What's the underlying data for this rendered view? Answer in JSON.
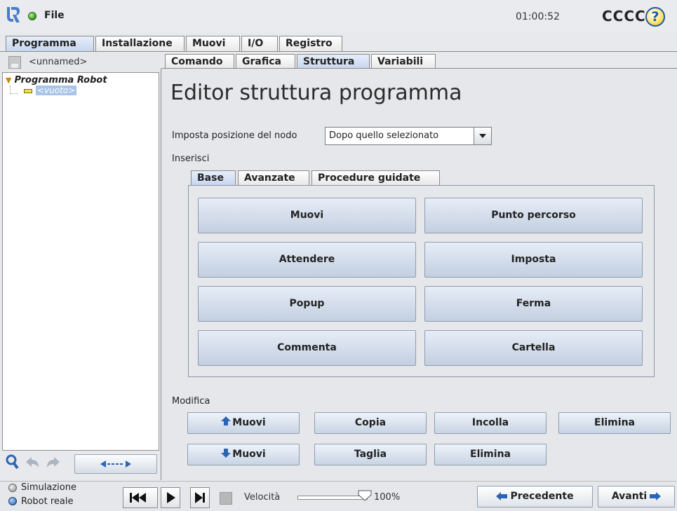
{
  "titlebar": {
    "menu_file": "File",
    "clock": "01:00:52",
    "robot_name": "CCCC",
    "help_glyph": "?"
  },
  "main_tabs": [
    {
      "label": "Programma"
    },
    {
      "label": "Installazione"
    },
    {
      "label": "Muovi"
    },
    {
      "label": "I/O"
    },
    {
      "label": "Registro"
    }
  ],
  "main_tab_active": "Programma",
  "tree": {
    "program_name": "<unnamed>",
    "root_label": "Programma Robot",
    "empty_label": "<vuoto>"
  },
  "sub_tabs": [
    {
      "label": "Comando"
    },
    {
      "label": "Grafica"
    },
    {
      "label": "Struttura"
    },
    {
      "label": "Variabili"
    }
  ],
  "sub_tab_active": "Struttura",
  "editor": {
    "title": "Editor struttura programma",
    "position_label": "Imposta posizione del nodo",
    "position_value": "Dopo quello selezionato",
    "insert_label": "Inserisci",
    "insert_tabs": [
      {
        "label": "Base"
      },
      {
        "label": "Avanzate"
      },
      {
        "label": "Procedure guidate"
      }
    ],
    "insert_tab_active": "Base",
    "insert_buttons": [
      {
        "label": "Muovi"
      },
      {
        "label": "Punto percorso"
      },
      {
        "label": "Attendere"
      },
      {
        "label": "Imposta"
      },
      {
        "label": "Popup"
      },
      {
        "label": "Ferma"
      },
      {
        "label": "Commenta"
      },
      {
        "label": "Cartella"
      }
    ],
    "modify_label": "Modifica",
    "modify_buttons": {
      "move_up": "Muovi",
      "copy": "Copia",
      "paste": "Incolla",
      "delete_1": "Elimina",
      "move_down": "Muovi",
      "cut": "Taglia",
      "delete_2": "Elimina"
    }
  },
  "footer": {
    "mode_simulation": "Simulazione",
    "mode_real": "Robot reale",
    "speed_label": "Velocità",
    "speed_value": "100%",
    "speed_fraction": 1.0,
    "prev_label": "Precedente",
    "next_label": "Avanti"
  },
  "colors": {
    "accent_blue": "#2b64b5",
    "button_top": "#e6edf7",
    "button_bottom": "#c3cfe0",
    "selected_node_bg": "#a9c4e8",
    "active_tab": "#c7d6ee"
  },
  "icons": {
    "logo": "ur-logo-icon",
    "status": "green-dot-icon",
    "help": "help-icon",
    "save": "save-icon",
    "search": "search-icon",
    "undo": "undo-arrow-icon",
    "redo": "redo-arrow-icon",
    "collapse": "collapse-expand-icon",
    "skip_back": "skip-back-icon",
    "play": "play-icon",
    "step": "step-icon",
    "stop": "stop-icon",
    "prev_arrow": "arrow-left-icon",
    "next_arrow": "arrow-right-icon"
  }
}
